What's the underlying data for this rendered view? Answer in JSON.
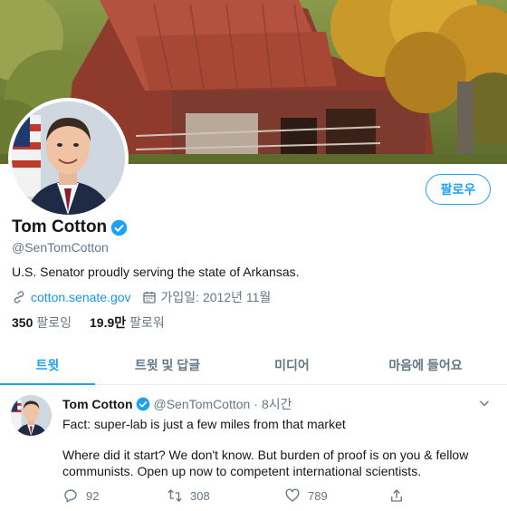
{
  "profile": {
    "display_name": "Tom Cotton",
    "handle": "@SenTomCotton",
    "bio": "U.S. Senator proudly serving the state of Arkansas.",
    "website": "cotton.senate.gov",
    "joined": "가입일: 2012년 11월",
    "follow_label": "팔로우",
    "following_count": "350",
    "following_label": "팔로잉",
    "followers_count": "19.9만",
    "followers_label": "팔로워"
  },
  "tabs": [
    {
      "label": "트윗"
    },
    {
      "label": "트윗 및 답글"
    },
    {
      "label": "미디어"
    },
    {
      "label": "마음에 들어요"
    }
  ],
  "tweet": {
    "name": "Tom Cotton",
    "handle": "@SenTomCotton",
    "separator": "·",
    "time": "8시간",
    "line1": "Fact: super-lab is just a few miles from that market",
    "line2": "Where did it start? We don't know. But burden of proof is on you & fellow communists. Open up now to competent international scientists.",
    "replies": "92",
    "retweets": "308",
    "likes": "789"
  },
  "colors": {
    "accent": "#1da1f2",
    "link": "#1b95e0",
    "muted": "#657786"
  },
  "icons": [
    "verified-badge-icon",
    "link-icon",
    "calendar-icon",
    "chevron-down-icon",
    "reply-icon",
    "retweet-icon",
    "like-icon",
    "share-icon"
  ]
}
